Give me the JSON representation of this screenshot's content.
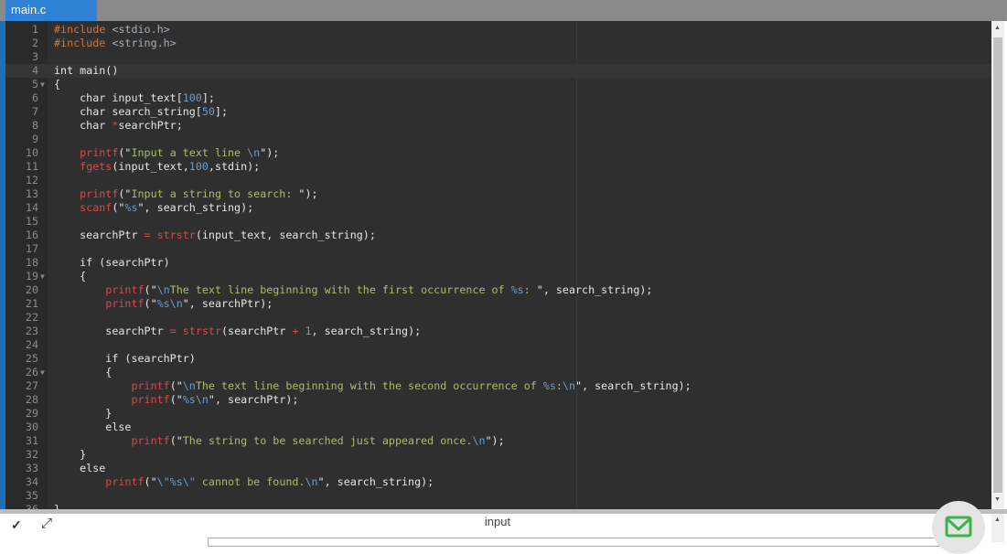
{
  "tab": {
    "title": "main.c"
  },
  "editor": {
    "lines": [
      [
        [
          "pp",
          "#include"
        ],
        [
          "pl",
          " "
        ],
        [
          "inc",
          "<stdio.h>"
        ]
      ],
      [
        [
          "pp",
          "#include"
        ],
        [
          "pl",
          " "
        ],
        [
          "inc",
          "<string.h>"
        ]
      ],
      [],
      [
        [
          "pl",
          "int main()"
        ]
      ],
      [
        [
          "pl",
          "{"
        ]
      ],
      [
        [
          "pl",
          "    char input_text["
        ],
        [
          "num",
          "100"
        ],
        [
          "pl",
          "];"
        ]
      ],
      [
        [
          "pl",
          "    char search_string["
        ],
        [
          "num",
          "50"
        ],
        [
          "pl",
          "];"
        ]
      ],
      [
        [
          "pl",
          "    char "
        ],
        [
          "op",
          "*"
        ],
        [
          "pl",
          "searchPtr;"
        ]
      ],
      [],
      [
        [
          "pl",
          "    "
        ],
        [
          "fn",
          "printf"
        ],
        [
          "pl",
          "(\""
        ],
        [
          "str",
          "Input a text line "
        ],
        [
          "esc",
          "\\n"
        ],
        [
          "pl",
          "\");"
        ]
      ],
      [
        [
          "pl",
          "    "
        ],
        [
          "fn",
          "fgets"
        ],
        [
          "pl",
          "(input_text,"
        ],
        [
          "num",
          "100"
        ],
        [
          "pl",
          ",stdin);"
        ]
      ],
      [],
      [
        [
          "pl",
          "    "
        ],
        [
          "fn",
          "printf"
        ],
        [
          "pl",
          "(\""
        ],
        [
          "str",
          "Input a string to search: "
        ],
        [
          "pl",
          "\");"
        ]
      ],
      [
        [
          "pl",
          "    "
        ],
        [
          "fn",
          "scanf"
        ],
        [
          "pl",
          "(\""
        ],
        [
          "esc",
          "%s"
        ],
        [
          "pl",
          "\", search_string);"
        ]
      ],
      [],
      [
        [
          "pl",
          "    searchPtr "
        ],
        [
          "op",
          "="
        ],
        [
          "pl",
          " "
        ],
        [
          "fn",
          "strstr"
        ],
        [
          "pl",
          "(input_text, search_string);"
        ]
      ],
      [],
      [
        [
          "pl",
          "    if (searchPtr)"
        ]
      ],
      [
        [
          "pl",
          "    {"
        ]
      ],
      [
        [
          "pl",
          "        "
        ],
        [
          "fn",
          "printf"
        ],
        [
          "pl",
          "(\""
        ],
        [
          "esc",
          "\\n"
        ],
        [
          "str",
          "The text line beginning with the first occurrence of "
        ],
        [
          "esc",
          "%s"
        ],
        [
          "str",
          ": "
        ],
        [
          "pl",
          "\", search_string);"
        ]
      ],
      [
        [
          "pl",
          "        "
        ],
        [
          "fn",
          "printf"
        ],
        [
          "pl",
          "(\""
        ],
        [
          "esc",
          "%s\\n"
        ],
        [
          "pl",
          "\", searchPtr);"
        ]
      ],
      [],
      [
        [
          "pl",
          "        searchPtr "
        ],
        [
          "op",
          "="
        ],
        [
          "pl",
          " "
        ],
        [
          "fn",
          "strstr"
        ],
        [
          "pl",
          "(searchPtr "
        ],
        [
          "op",
          "+"
        ],
        [
          "pl",
          " "
        ],
        [
          "num",
          "1"
        ],
        [
          "pl",
          ", search_string);"
        ]
      ],
      [],
      [
        [
          "pl",
          "        if (searchPtr)"
        ]
      ],
      [
        [
          "pl",
          "        {"
        ]
      ],
      [
        [
          "pl",
          "            "
        ],
        [
          "fn",
          "printf"
        ],
        [
          "pl",
          "(\""
        ],
        [
          "esc",
          "\\n"
        ],
        [
          "str",
          "The text line beginning with the second occurrence of "
        ],
        [
          "esc",
          "%s"
        ],
        [
          "str",
          ":"
        ],
        [
          "esc",
          "\\n"
        ],
        [
          "pl",
          "\", search_string);"
        ]
      ],
      [
        [
          "pl",
          "            "
        ],
        [
          "fn",
          "printf"
        ],
        [
          "pl",
          "(\""
        ],
        [
          "esc",
          "%s\\n"
        ],
        [
          "pl",
          "\", searchPtr);"
        ]
      ],
      [
        [
          "pl",
          "        }"
        ]
      ],
      [
        [
          "pl",
          "        else"
        ]
      ],
      [
        [
          "pl",
          "            "
        ],
        [
          "fn",
          "printf"
        ],
        [
          "pl",
          "(\""
        ],
        [
          "str",
          "The string to be searched just appeared once."
        ],
        [
          "esc",
          "\\n"
        ],
        [
          "pl",
          "\");"
        ]
      ],
      [
        [
          "pl",
          "    }"
        ]
      ],
      [
        [
          "pl",
          "    else"
        ]
      ],
      [
        [
          "pl",
          "        "
        ],
        [
          "fn",
          "printf"
        ],
        [
          "pl",
          "(\""
        ],
        [
          "esc",
          "\\\""
        ],
        [
          "esc",
          "%s"
        ],
        [
          "esc",
          "\\\""
        ],
        [
          "str",
          " cannot be found."
        ],
        [
          "esc",
          "\\n"
        ],
        [
          "pl",
          "\", search_string);"
        ]
      ],
      [],
      [
        [
          "pl",
          "}"
        ]
      ]
    ],
    "fold_lines": [
      5,
      19,
      26
    ],
    "active_line": 4
  },
  "panel": {
    "label": "input"
  }
}
